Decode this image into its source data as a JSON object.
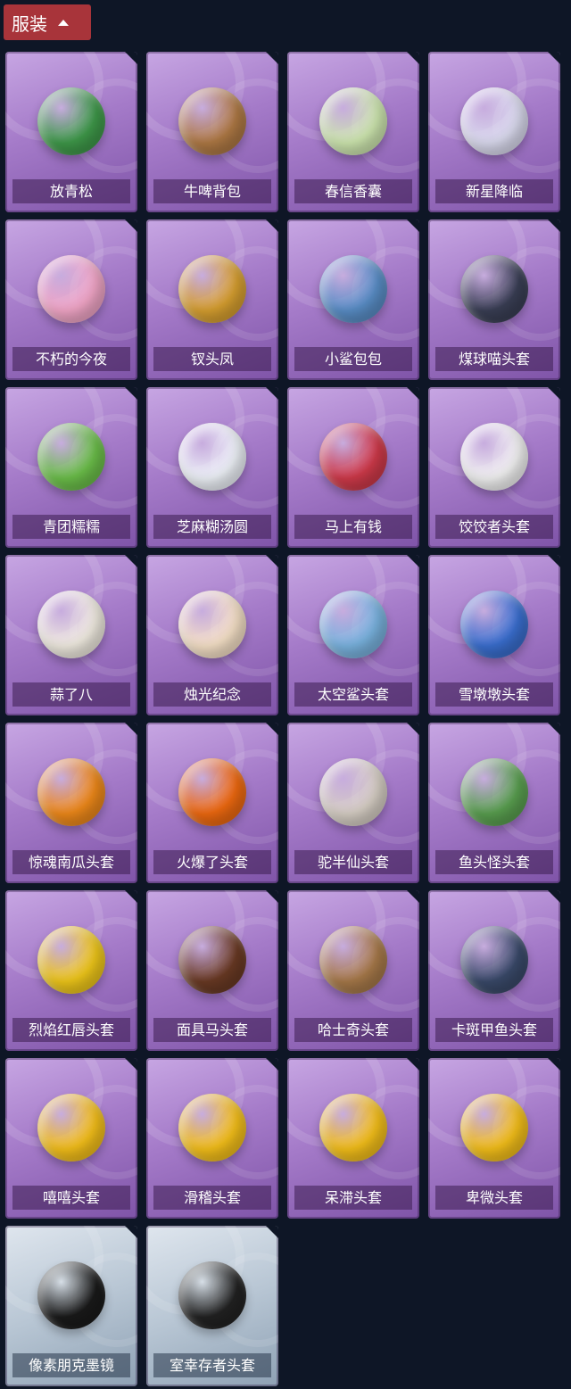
{
  "section": {
    "label": "服装"
  },
  "items": [
    {
      "name": "放青松",
      "icon": "pine-bonsai-icon",
      "color": "#3f9a4a"
    },
    {
      "name": "牛啤背包",
      "icon": "cow-barrel-icon",
      "color": "#b07a45"
    },
    {
      "name": "春信香囊",
      "icon": "sachet-icon",
      "color": "#cfe8b0"
    },
    {
      "name": "新星降临",
      "icon": "doll-keychain-icon",
      "color": "#dcdcf0"
    },
    {
      "name": "不朽的今夜",
      "icon": "pink-fox-icon",
      "color": "#f3a7c8"
    },
    {
      "name": "钗头凤",
      "icon": "phoenix-crown-icon",
      "color": "#d8a030"
    },
    {
      "name": "小鲨包包",
      "icon": "shark-charm-icon",
      "color": "#5a8fc8"
    },
    {
      "name": "煤球喵头套",
      "icon": "black-cat-icon",
      "color": "#3a3f55"
    },
    {
      "name": "青团糯糯",
      "icon": "green-dumpling-icon",
      "color": "#6cc04a"
    },
    {
      "name": "芝麻糊汤圆",
      "icon": "white-dumpling-icon",
      "color": "#f0f4fa"
    },
    {
      "name": "马上有钱",
      "icon": "red-horse-icon",
      "color": "#d03a4a"
    },
    {
      "name": "饺饺者头套",
      "icon": "dumpling-cloud-icon",
      "color": "#f4f4f4"
    },
    {
      "name": "蒜了八",
      "icon": "garlic-icon",
      "color": "#f2ede2"
    },
    {
      "name": "烛光纪念",
      "icon": "candle-icon",
      "color": "#f7e2c8"
    },
    {
      "name": "太空鲨头套",
      "icon": "space-shark-icon",
      "color": "#7ab4e0"
    },
    {
      "name": "雪墩墩头套",
      "icon": "snowman-icon",
      "color": "#3a6fd0"
    },
    {
      "name": "惊魂南瓜头套",
      "icon": "pumpkin-icon",
      "color": "#f08a1a"
    },
    {
      "name": "火爆了头套",
      "icon": "fire-icon",
      "color": "#f06a10"
    },
    {
      "name": "驼半仙头套",
      "icon": "bear-sunglasses-icon",
      "color": "#d8d0c6"
    },
    {
      "name": "鱼头怪头套",
      "icon": "fish-head-icon",
      "color": "#5aa050"
    },
    {
      "name": "烈焰红唇头套",
      "icon": "pikachu-icon",
      "color": "#f0c81a"
    },
    {
      "name": "面具马头套",
      "icon": "horse-mask-icon",
      "color": "#6a3a24"
    },
    {
      "name": "哈士奇头套",
      "icon": "husky-icon",
      "color": "#a87a4a"
    },
    {
      "name": "卡斑甲鱼头套",
      "icon": "turtle-icon",
      "color": "#3a4a6a"
    },
    {
      "name": "嘻嘻头套",
      "icon": "grin-emoji-icon",
      "color": "#f5c01a"
    },
    {
      "name": "滑稽头套",
      "icon": "smirk-emoji-icon",
      "color": "#f5c01a"
    },
    {
      "name": "呆滞头套",
      "icon": "stare-emoji-icon",
      "color": "#f5c01a"
    },
    {
      "name": "卑微头套",
      "icon": "humble-emoji-icon",
      "color": "#f5c01a"
    },
    {
      "name": "像素朋克墨镜",
      "icon": "pixel-sunglasses-icon",
      "color": "#1a1a1a",
      "rare": true
    },
    {
      "name": "室幸存者头套",
      "icon": "gas-mask-icon",
      "color": "#222222",
      "rare": true
    }
  ]
}
